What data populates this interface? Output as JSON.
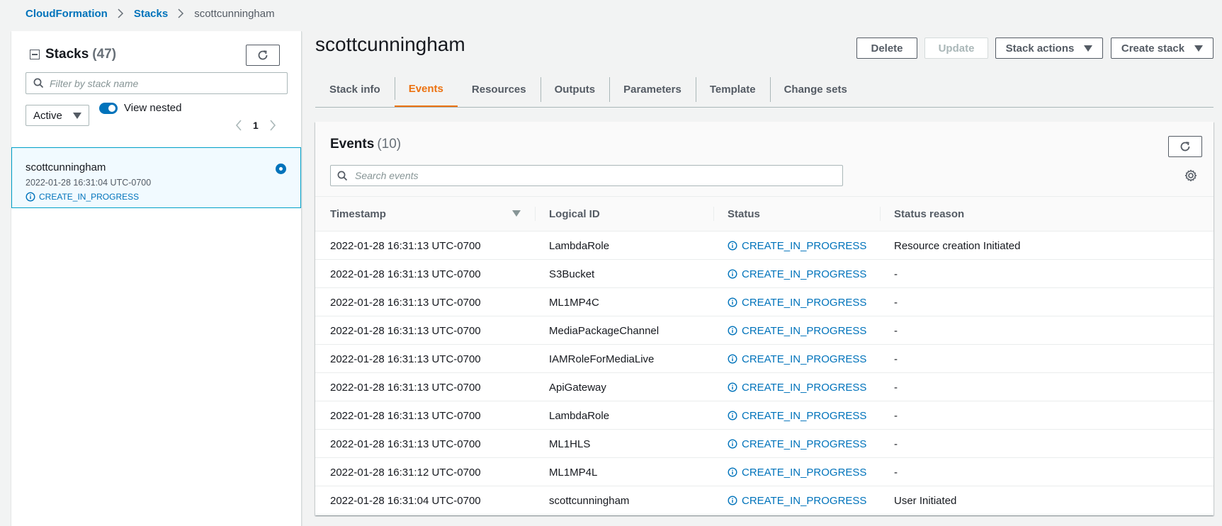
{
  "breadcrumb": {
    "root": "CloudFormation",
    "section": "Stacks",
    "current": "scottcunningham"
  },
  "sidebar": {
    "title": "Stacks",
    "count": "(47)",
    "filter_placeholder": "Filter by stack name",
    "status_filter": "Active",
    "view_nested_label": "View nested",
    "view_nested_on": true,
    "page": "1",
    "stack": {
      "name": "scottcunningham",
      "date": "2022-01-28 16:31:04 UTC-0700",
      "status": "CREATE_IN_PROGRESS"
    }
  },
  "header": {
    "title": "scottcunningham",
    "delete_label": "Delete",
    "update_label": "Update",
    "stack_actions_label": "Stack actions",
    "create_stack_label": "Create stack"
  },
  "tabs": [
    "Stack info",
    "Events",
    "Resources",
    "Outputs",
    "Parameters",
    "Template",
    "Change sets"
  ],
  "active_tab": "Events",
  "events": {
    "title": "Events",
    "count": "(10)",
    "search_placeholder": "Search events",
    "columns": [
      "Timestamp",
      "Logical ID",
      "Status",
      "Status reason"
    ],
    "rows": [
      {
        "timestamp": "2022-01-28 16:31:13 UTC-0700",
        "logical_id": "LambdaRole",
        "status": "CREATE_IN_PROGRESS",
        "reason": "Resource creation Initiated"
      },
      {
        "timestamp": "2022-01-28 16:31:13 UTC-0700",
        "logical_id": "S3Bucket",
        "status": "CREATE_IN_PROGRESS",
        "reason": "-"
      },
      {
        "timestamp": "2022-01-28 16:31:13 UTC-0700",
        "logical_id": "ML1MP4C",
        "status": "CREATE_IN_PROGRESS",
        "reason": "-"
      },
      {
        "timestamp": "2022-01-28 16:31:13 UTC-0700",
        "logical_id": "MediaPackageChannel",
        "status": "CREATE_IN_PROGRESS",
        "reason": "-"
      },
      {
        "timestamp": "2022-01-28 16:31:13 UTC-0700",
        "logical_id": "IAMRoleForMediaLive",
        "status": "CREATE_IN_PROGRESS",
        "reason": "-"
      },
      {
        "timestamp": "2022-01-28 16:31:13 UTC-0700",
        "logical_id": "ApiGateway",
        "status": "CREATE_IN_PROGRESS",
        "reason": "-"
      },
      {
        "timestamp": "2022-01-28 16:31:13 UTC-0700",
        "logical_id": "LambdaRole",
        "status": "CREATE_IN_PROGRESS",
        "reason": "-"
      },
      {
        "timestamp": "2022-01-28 16:31:13 UTC-0700",
        "logical_id": "ML1HLS",
        "status": "CREATE_IN_PROGRESS",
        "reason": "-"
      },
      {
        "timestamp": "2022-01-28 16:31:12 UTC-0700",
        "logical_id": "ML1MP4L",
        "status": "CREATE_IN_PROGRESS",
        "reason": "-"
      },
      {
        "timestamp": "2022-01-28 16:31:04 UTC-0700",
        "logical_id": "scottcunningham",
        "status": "CREATE_IN_PROGRESS",
        "reason": "User Initiated"
      }
    ]
  },
  "colors": {
    "link": "#0073bb",
    "active_tab": "#ec7211",
    "selected_bg": "#f1faff",
    "selected_border": "#00a1c9"
  },
  "icons": {
    "refresh": "refresh-icon",
    "search": "search-icon",
    "info": "info-icon",
    "gear": "gear-icon",
    "chevron_left": "chevron-left-icon",
    "chevron_right": "chevron-right-icon",
    "caret_down": "caret-down-icon"
  }
}
